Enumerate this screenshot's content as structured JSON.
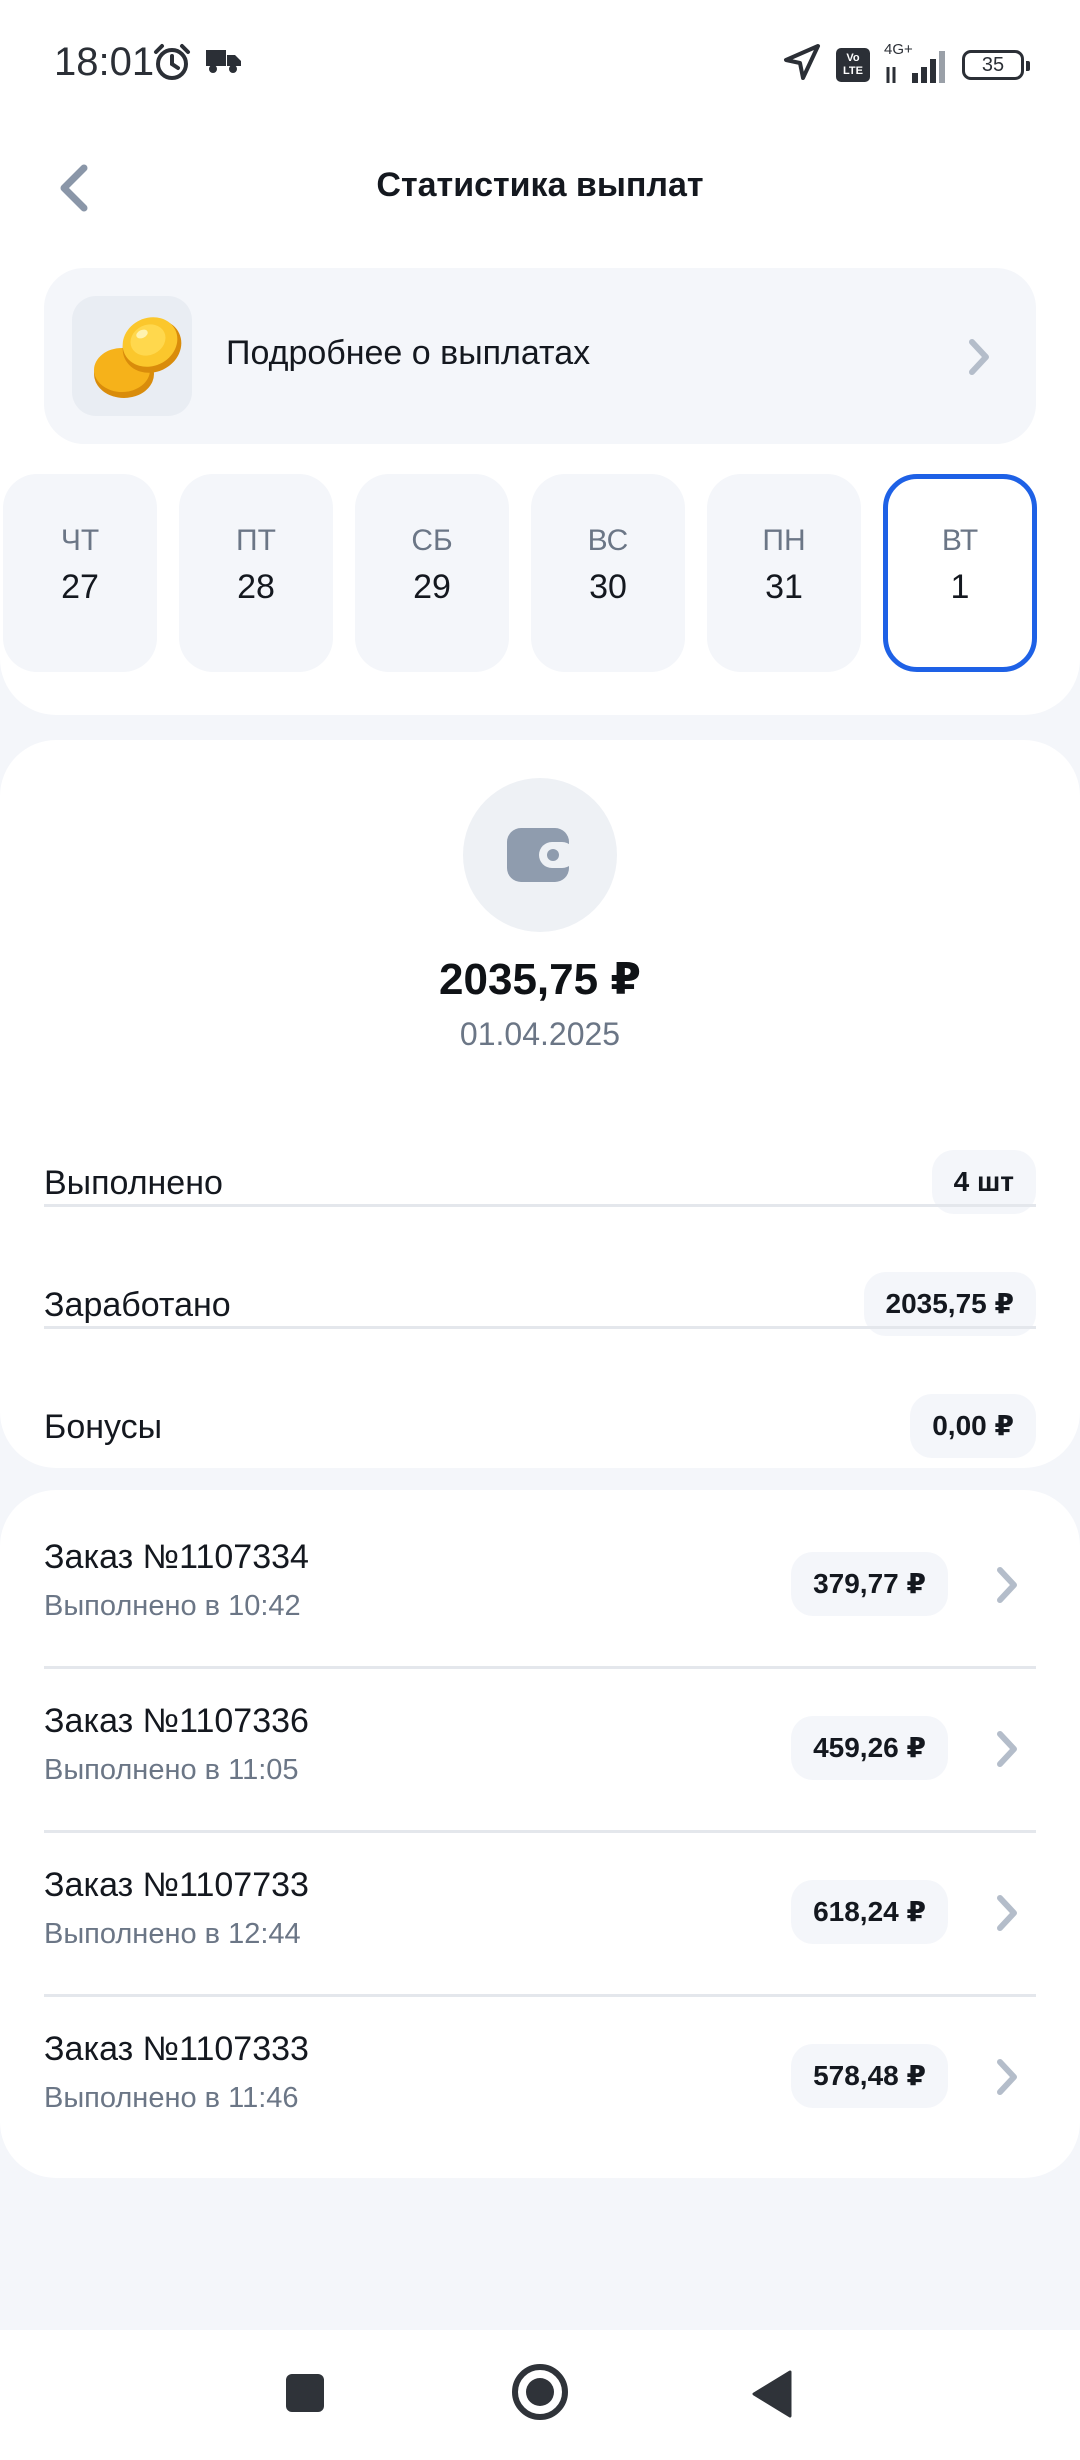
{
  "status_bar": {
    "time": "18:01",
    "volte": "Vo LTE",
    "network": "4G+",
    "battery": "35"
  },
  "header": {
    "title": "Статистика выплат"
  },
  "info_card": {
    "label": "Подробнее о выплатах"
  },
  "days": [
    {
      "name": "ЧТ",
      "num": "27"
    },
    {
      "name": "ПТ",
      "num": "28"
    },
    {
      "name": "СБ",
      "num": "29"
    },
    {
      "name": "ВС",
      "num": "30"
    },
    {
      "name": "ПН",
      "num": "31"
    },
    {
      "name": "ВТ",
      "num": "1"
    }
  ],
  "selected_day_index": 5,
  "summary": {
    "total": "2035,75 ₽",
    "date": "01.04.2025",
    "rows": [
      {
        "label": "Выполнено",
        "value": "4 шт"
      },
      {
        "label": "Заработано",
        "value": "2035,75 ₽"
      },
      {
        "label": "Бонусы",
        "value": "0,00 ₽"
      }
    ]
  },
  "orders": [
    {
      "title": "Заказ №1107334",
      "time": "Выполнено в 10:42",
      "amount": "379,77 ₽"
    },
    {
      "title": "Заказ №1107336",
      "time": "Выполнено в 11:05",
      "amount": "459,26 ₽"
    },
    {
      "title": "Заказ №1107733",
      "time": "Выполнено в 12:44",
      "amount": "618,24 ₽"
    },
    {
      "title": "Заказ №1107333",
      "time": "Выполнено в 11:46",
      "amount": "578,48 ₽"
    }
  ],
  "colors": {
    "accent": "#1e61e6",
    "background": "#f4f6fa",
    "secondary_text": "#6b7686"
  },
  "icons": [
    "alarm-icon",
    "truck-icon",
    "location-arrow-icon",
    "signal-icon",
    "battery-icon",
    "back-arrow-icon",
    "coins-icon",
    "chevron-right-icon",
    "wallet-icon",
    "nav-recents-icon",
    "nav-home-icon",
    "nav-back-icon"
  ]
}
